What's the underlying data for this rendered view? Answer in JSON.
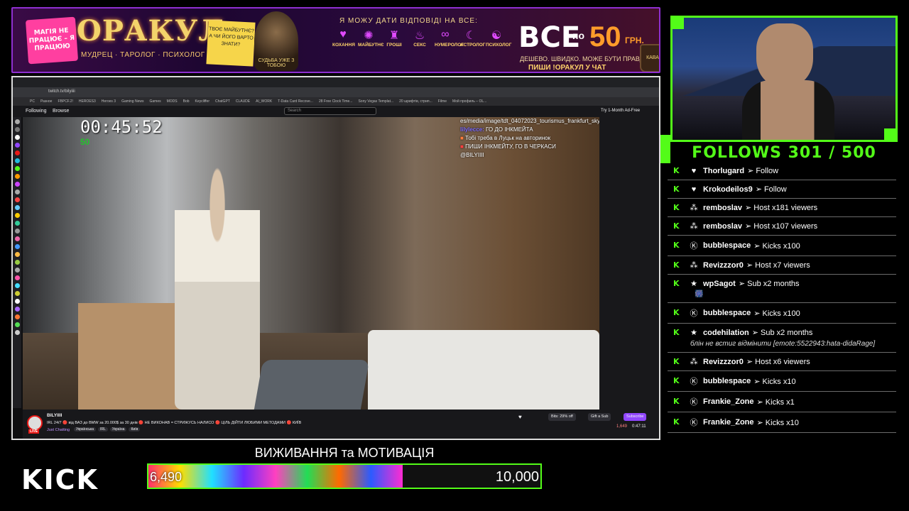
{
  "banner": {
    "sticky_text": "МАГІЯ НЕ ПРАЦЮЄ – Я ПРАЦЮЮ",
    "title": "ОРАКУЛ",
    "subtitle": "МУДРЕЦ · ТАРОЛОГ · ПСИХОЛОГ",
    "note": "ТВОЄ МАЙБУТНЄ? А ЧИ ЙОГО ВАРТО ЗНАТИ?",
    "badge": "СУДЬБА УЖЕ З ТОБОЮ",
    "headline": "Я МОЖУ ДАТИ ВІДПОВІДІ НА ВСЕ:",
    "categories": [
      {
        "icon": "♥",
        "label": "КОХАННЯ"
      },
      {
        "icon": "✺",
        "label": "МАЙБУТНЄ"
      },
      {
        "icon": "♜",
        "label": "ГРОШІ"
      },
      {
        "icon": "♨",
        "label": "СЕКС"
      },
      {
        "icon": "∞",
        "label": "НУМЕРОЛОГ"
      },
      {
        "icon": "☾",
        "label": "АСТРОЛОГ"
      },
      {
        "icon": "☯",
        "label": "ПСИХОЛОГ"
      }
    ],
    "price_all": "ВСЕ",
    "price_po": "по",
    "price_num": "50",
    "price_cur": "ГРН.",
    "price_line2": "ДЕШЕВО. ШВИДКО. МОЖЕ БУТИ ПРАВДА.",
    "price_line3": "ПИШИ !ОРАКУЛ У ЧАТ",
    "mug_text": "КАВА"
  },
  "browser": {
    "url": "twitch.tv/bilyiiii",
    "bookmarks": [
      "PC",
      "Разное",
      "FBPCF.2!",
      "HEROES3",
      "Heroes 3",
      "Gaming News",
      "Games",
      "MODS",
      "Bob",
      "Keycliffer",
      "ChatGPT",
      "CLAUDE",
      "AI_WORK",
      "T-Data Card Recove...",
      "28 Free Clock Time...",
      "Sony Vegas Templat...",
      "20 шрифтів, стрип...",
      "Filme",
      "Мой профиль – OL..."
    ]
  },
  "twitch": {
    "nav_following": "Following",
    "nav_browse": "Browse",
    "search_placeholder": "Search",
    "ad_free": "Try 1-Month Ad-Free",
    "streamer": "BILYIIII",
    "stream_title": "IRL 24/7 🔴 від ВАЗ до BMW за 20.000$ за 30 днів 🔴 НЕ ВИКОНАВ = СТРИЖУСЬ НАЛИСО 🔴 ЦІЛЬ ДІЙТИ ЛЮБИМИ МЕТОДАМИ 🔴 КИЇВ",
    "category": "Just Chatting",
    "tags": [
      "Українська",
      "IRL",
      "Україна",
      "Київ"
    ],
    "live": "LIVE",
    "bits": "Bits: 29% off",
    "gift": "Gift a Sub",
    "subscribe": "Subscribe",
    "viewers": "1,649",
    "uptime": "0:47:11"
  },
  "video": {
    "timer": "00:45:52",
    "timer_sub": "50",
    "chat": [
      {
        "user": "",
        "text": "es/media/image/tdt_04072023_tourismus_frankfurt_skyline.jpg",
        "color": "#ffffff"
      },
      {
        "user": "lilylecce:",
        "text": "ГО ДО ІНКМЕЙТА",
        "color": "#7c6bff"
      },
      {
        "user": "",
        "text": "Тобі треба в Луцьк на авторинок",
        "color": "#ff7a3a"
      },
      {
        "user": "",
        "text": "ПИШИ ІНКМЕЙТУ, ГО В ЧЕРКАСИ",
        "color": "#ff4040"
      },
      {
        "user": "",
        "text": "@BILYIIII",
        "color": "#ffffff"
      }
    ]
  },
  "follows": "FOLLOWS 301 / 500",
  "events": [
    {
      "type": "heart",
      "icon": "♥",
      "name": "Thorlugard",
      "action": "➢ Follow"
    },
    {
      "type": "heart",
      "icon": "♥",
      "name": "Krokodeilos9",
      "action": "➢ Follow"
    },
    {
      "type": "host",
      "icon": "⁂",
      "name": "remboslav",
      "action": "➢ Host x181 viewers"
    },
    {
      "type": "host",
      "icon": "⁂",
      "name": "remboslav",
      "action": "➢ Host x107 viewers"
    },
    {
      "type": "kick",
      "icon": "Ⓚ",
      "name": "bubblespace",
      "action": "➢ Kicks x100"
    },
    {
      "type": "host",
      "icon": "⁂",
      "name": "Revizzzor0",
      "action": "➢ Host x7 viewers"
    },
    {
      "type": "sub",
      "icon": "★",
      "name": "wpSagot",
      "action": "➢ Sub x2 months",
      "emote": "🎆"
    },
    {
      "type": "kick",
      "icon": "Ⓚ",
      "name": "bubblespace",
      "action": "➢ Kicks x100"
    },
    {
      "type": "sub",
      "icon": "★",
      "name": "codehilation",
      "action": "➢ Sub x2 months",
      "msg": "блін не встиг відмінити [emote:5522943:hata-didaRage]"
    },
    {
      "type": "host",
      "icon": "⁂",
      "name": "Revizzzor0",
      "action": "➢ Host x6 viewers"
    },
    {
      "type": "kick",
      "icon": "Ⓚ",
      "name": "bubblespace",
      "action": "➢ Kicks x10"
    },
    {
      "type": "kick",
      "icon": "Ⓚ",
      "name": "Frankie_Zone",
      "action": "➢ Kicks x1"
    },
    {
      "type": "kick",
      "icon": "Ⓚ",
      "name": "Frankie_Zone",
      "action": "➢ Kicks x10"
    }
  ],
  "kick_logo": "KICK",
  "goal": {
    "title": "ВИЖИВАННЯ та МОТИВАЦІЯ",
    "current": "6,490",
    "max": "10,000",
    "progress": 0.649
  },
  "colors": {
    "kick_green": "#53fc18",
    "twitch_purple": "#9147ff",
    "banner_border": "#8e2fd0"
  }
}
